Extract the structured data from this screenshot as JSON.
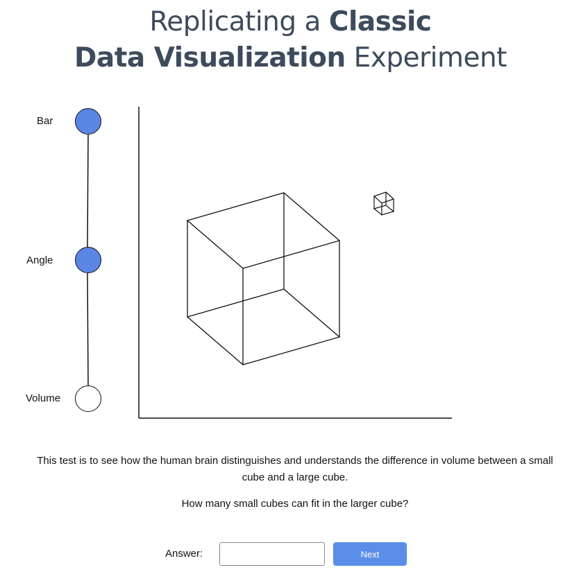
{
  "header": {
    "title_line1_light": "Replicating a ",
    "title_line1_bold": "Classic",
    "title_line2_bold": "Data Visualization",
    "title_line2_light": " Experiment"
  },
  "progress": {
    "steps": [
      {
        "label": "Bar",
        "status": "complete"
      },
      {
        "label": "Angle",
        "status": "complete"
      },
      {
        "label": "Volume",
        "status": "current"
      }
    ],
    "complete_color": "#5b86e5"
  },
  "stimulus": {
    "description": "Two wireframe cubes on blank axes: one large cube and one small cube."
  },
  "instructions": {
    "description": "This test is to see how the human brain distinguishes and understands the difference in volume between a small cube and a large cube.",
    "question": "How many small cubes can fit in the larger cube?"
  },
  "answer": {
    "label": "Answer:",
    "value": "",
    "placeholder": ""
  },
  "next_button": {
    "label": "Next",
    "color": "#5b8ee9"
  }
}
